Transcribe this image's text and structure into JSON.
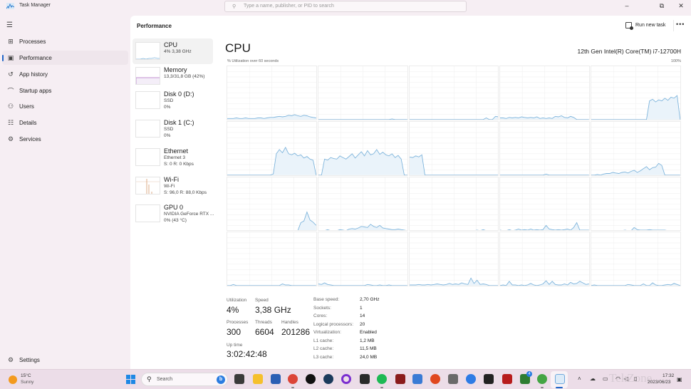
{
  "window": {
    "title": "Task Manager",
    "search_placeholder": "Type a name, publisher, or PID to search",
    "controls": {
      "minimize": "–",
      "restore": "⧉",
      "close": "✕"
    }
  },
  "nav": {
    "menu_icon": "hamburger-icon",
    "items": [
      {
        "label": "Processes",
        "icon": "processes-icon",
        "active": false
      },
      {
        "label": "Performance",
        "icon": "performance-icon",
        "active": true
      },
      {
        "label": "App history",
        "icon": "history-icon",
        "active": false
      },
      {
        "label": "Startup apps",
        "icon": "startup-icon",
        "active": false
      },
      {
        "label": "Users",
        "icon": "users-icon",
        "active": false
      },
      {
        "label": "Details",
        "icon": "details-icon",
        "active": false
      },
      {
        "label": "Services",
        "icon": "services-icon",
        "active": false
      }
    ],
    "settings_label": "Settings"
  },
  "header": {
    "title": "Performance",
    "run_new_task": "Run new task",
    "more": "•••"
  },
  "devices": [
    {
      "name": "CPU",
      "sub1": "4%  3,38 GHz",
      "sub2": "",
      "active": true
    },
    {
      "name": "Memory",
      "sub1": "13,3/31,8 GB (42%)",
      "sub2": "",
      "active": false
    },
    {
      "name": "Disk 0 (D:)",
      "sub1": "SSD",
      "sub2": "0%",
      "active": false
    },
    {
      "name": "Disk 1 (C:)",
      "sub1": "SSD",
      "sub2": "0%",
      "active": false
    },
    {
      "name": "Ethernet",
      "sub1": "Ethernet 3",
      "sub2": "S: 0  R: 0 Kbps",
      "active": false
    },
    {
      "name": "Wi-Fi",
      "sub1": "Wi-Fi",
      "sub2": "S: 96,0  R: 88,0 Kbps",
      "active": false
    },
    {
      "name": "GPU 0",
      "sub1": "NVIDIA GeForce RTX ...",
      "sub2": "0%  (43 °C)",
      "active": false
    }
  ],
  "cpu": {
    "title": "CPU",
    "model": "12th Gen Intel(R) Core(TM) i7-12700H",
    "graph_label": "% Utilization over 60 seconds",
    "graph_max": "100%",
    "colors": {
      "line": "#7fb5dc",
      "fill": "#eaf3fa",
      "grid": "#f0f0f0"
    },
    "stats": {
      "utilization": {
        "label": "Utilization",
        "value": "4%"
      },
      "speed": {
        "label": "Speed",
        "value": "3,38 GHz"
      },
      "processes": {
        "label": "Processes",
        "value": "300"
      },
      "threads": {
        "label": "Threads",
        "value": "6604"
      },
      "handles": {
        "label": "Handles",
        "value": "201286"
      },
      "uptime": {
        "label": "Up time",
        "value": "3:02:42:48"
      }
    },
    "specs": [
      {
        "label": "Base speed:",
        "value": "2,70 GHz"
      },
      {
        "label": "Sockets:",
        "value": "1"
      },
      {
        "label": "Cores:",
        "value": "14"
      },
      {
        "label": "Logical processors:",
        "value": "20"
      },
      {
        "label": "Virtualization:",
        "value": "Enabled"
      },
      {
        "label": "L1 cache:",
        "value": "1,2 MB"
      },
      {
        "label": "L2 cache:",
        "value": "11,5 MB"
      },
      {
        "label": "L3 cache:",
        "value": "24,0 MB"
      }
    ]
  },
  "chart_data": {
    "type": "area",
    "title": "% Utilization over 60 seconds",
    "ylim": [
      0,
      100
    ],
    "xlim_seconds": [
      60,
      0
    ],
    "grid": true,
    "layout_cols": 5,
    "layout_rows": 4,
    "series": [
      {
        "name": "LP0",
        "values": [
          2,
          2,
          2,
          3,
          2,
          2,
          3,
          2,
          2,
          2,
          3,
          3,
          2,
          3,
          4,
          4,
          5,
          6,
          5,
          6,
          8,
          7,
          9,
          7,
          6,
          8,
          7,
          5,
          4,
          3
        ]
      },
      {
        "name": "LP1",
        "values": [
          0,
          0,
          0,
          0,
          0,
          0,
          0,
          0,
          0,
          0,
          0,
          0,
          0,
          0,
          0,
          0,
          0,
          0,
          0,
          0,
          0,
          0,
          0,
          0,
          1,
          0,
          0,
          0,
          0,
          0
        ]
      },
      {
        "name": "LP2",
        "values": [
          0,
          0,
          0,
          0,
          0,
          0,
          0,
          0,
          0,
          0,
          0,
          0,
          0,
          0,
          0,
          0,
          0,
          0,
          0,
          0,
          0,
          0,
          0,
          0,
          0,
          3,
          0,
          0,
          6,
          5
        ]
      },
      {
        "name": "LP3",
        "values": [
          3,
          3,
          2,
          4,
          3,
          4,
          3,
          5,
          4,
          3,
          4,
          3,
          5,
          2,
          3,
          2,
          3,
          2,
          6,
          5,
          7,
          4,
          3,
          6,
          4,
          0,
          0,
          0,
          0,
          0
        ]
      },
      {
        "name": "LP4",
        "values": [
          0,
          0,
          0,
          0,
          0,
          0,
          0,
          0,
          0,
          0,
          0,
          0,
          0,
          0,
          0,
          0,
          0,
          0,
          0,
          35,
          38,
          33,
          37,
          35,
          40,
          36,
          42,
          40,
          45,
          0
        ]
      },
      {
        "name": "LP5",
        "values": [
          0,
          0,
          0,
          0,
          0,
          0,
          0,
          0,
          0,
          0,
          0,
          0,
          0,
          0,
          0,
          2,
          40,
          48,
          42,
          52,
          40,
          38,
          41,
          36,
          38,
          32,
          35,
          30,
          28,
          0
        ]
      },
      {
        "name": "LP6",
        "values": [
          0,
          0,
          30,
          28,
          33,
          31,
          30,
          36,
          33,
          30,
          35,
          40,
          32,
          38,
          44,
          36,
          46,
          38,
          40,
          48,
          39,
          43,
          38,
          36,
          40,
          33,
          37,
          30,
          0,
          0
        ]
      },
      {
        "name": "LP7",
        "values": [
          34,
          33,
          36,
          34,
          38,
          0,
          0,
          0,
          0,
          0,
          0,
          0,
          0,
          0,
          0,
          0,
          0,
          0,
          0,
          0,
          0,
          0,
          0,
          0,
          0,
          0,
          0,
          0,
          0,
          0
        ]
      },
      {
        "name": "LP8",
        "values": [
          0,
          0,
          0,
          0,
          0,
          0,
          0,
          0,
          0,
          0,
          0,
          0,
          0,
          0,
          0,
          2,
          0,
          0,
          0,
          0,
          0,
          0,
          0,
          0,
          0,
          0,
          0,
          0,
          0,
          0
        ]
      },
      {
        "name": "LP9",
        "values": [
          0,
          0,
          1,
          0,
          2,
          3,
          3,
          5,
          4,
          3,
          5,
          6,
          4,
          7,
          9,
          5,
          8,
          12,
          16,
          10,
          14,
          15,
          22,
          18,
          0,
          0,
          0,
          0,
          0,
          0
        ]
      },
      {
        "name": "LP10",
        "values": [
          0,
          0,
          0,
          0,
          0,
          0,
          0,
          0,
          0,
          0,
          0,
          0,
          0,
          0,
          0,
          0,
          0,
          0,
          0,
          0,
          0,
          0,
          0,
          0,
          15,
          18,
          35,
          20,
          16,
          10
        ]
      },
      {
        "name": "LP11",
        "values": [
          0,
          0,
          0,
          2,
          0,
          0,
          0,
          2,
          1,
          0,
          3,
          4,
          3,
          5,
          8,
          7,
          6,
          12,
          8,
          6,
          10,
          5,
          4,
          3,
          2,
          2,
          3,
          2,
          1,
          0
        ]
      },
      {
        "name": "LP12",
        "values": [
          0,
          0,
          0,
          0,
          0,
          0,
          0,
          0,
          0,
          0,
          0,
          0,
          0,
          0,
          0,
          0,
          0,
          0,
          0,
          0,
          0,
          0,
          1,
          0,
          2,
          0,
          0,
          0,
          0,
          0
        ]
      },
      {
        "name": "LP13",
        "values": [
          1,
          0,
          0,
          2,
          0,
          1,
          3,
          1,
          2,
          1,
          3,
          1,
          2,
          1,
          2,
          10,
          3,
          2,
          1,
          2,
          1,
          2,
          3,
          1,
          6,
          15,
          1,
          1,
          1,
          1
        ]
      },
      {
        "name": "LP14",
        "values": [
          0,
          0,
          0,
          0,
          0,
          0,
          0,
          0,
          0,
          0,
          0,
          1,
          0,
          0,
          6,
          2,
          1,
          1,
          1,
          2,
          1,
          1,
          1,
          1,
          1,
          0,
          0,
          0,
          0,
          0
        ]
      },
      {
        "name": "LP15",
        "values": [
          0,
          0,
          2,
          0,
          0,
          0,
          0,
          0,
          0,
          0,
          0,
          0,
          0,
          0,
          0,
          0,
          0,
          0,
          3,
          1,
          1,
          0,
          0,
          0,
          0,
          0,
          0,
          0,
          0,
          0
        ]
      },
      {
        "name": "LP16",
        "values": [
          3,
          2,
          5,
          2,
          1,
          0,
          0,
          0,
          0,
          0,
          0,
          0,
          0,
          0,
          0,
          0,
          2,
          1,
          0,
          0,
          1,
          0,
          0,
          1,
          0,
          0,
          0,
          0,
          0,
          0
        ]
      },
      {
        "name": "LP17",
        "values": [
          1,
          1,
          1,
          2,
          1,
          1,
          2,
          1,
          2,
          3,
          2,
          1,
          2,
          4,
          2,
          3,
          2,
          5,
          3,
          2,
          14,
          4,
          10,
          2,
          3,
          2,
          0,
          0,
          0,
          0
        ]
      },
      {
        "name": "LP18",
        "values": [
          0,
          1,
          0,
          8,
          1,
          1,
          0,
          1,
          0,
          1,
          4,
          1,
          0,
          1,
          3,
          9,
          2,
          8,
          2,
          1,
          1,
          3,
          1,
          6,
          3,
          4,
          8,
          5,
          2,
          3
        ]
      },
      {
        "name": "LP19",
        "values": [
          0,
          1,
          0,
          0,
          0,
          0,
          0,
          0,
          0,
          0,
          0,
          0,
          2,
          1,
          0,
          0,
          0,
          3,
          0,
          0,
          5,
          1,
          0,
          0,
          1,
          2,
          1,
          4,
          2,
          0
        ]
      }
    ]
  },
  "taskbar": {
    "weather": {
      "temp": "15°C",
      "condition": "Sunny"
    },
    "search_label": "Search",
    "apps": [
      {
        "name": "task-view",
        "color": "#3a3a3a",
        "running": false
      },
      {
        "name": "file-explorer",
        "color": "#f5c02c",
        "running": false
      },
      {
        "name": "microsoft-store",
        "color": "#2b5fb4",
        "running": false
      },
      {
        "name": "chrome",
        "color": "#db4437",
        "running": true
      },
      {
        "name": "logitech-g-hub",
        "color": "#111111",
        "running": false
      },
      {
        "name": "steam",
        "color": "#1b3a5c",
        "running": false
      },
      {
        "name": "cortana",
        "color": "#7b2fd0",
        "running": false
      },
      {
        "name": "epic-games",
        "color": "#2a2a2a",
        "running": false
      },
      {
        "name": "spotify",
        "color": "#1db954",
        "running": true
      },
      {
        "name": "game-app",
        "color": "#8a1c1c",
        "running": false
      },
      {
        "name": "network-app",
        "color": "#3a7bd5",
        "running": false
      },
      {
        "name": "ea-app",
        "color": "#e0481f",
        "running": false
      },
      {
        "name": "quake",
        "color": "#6a6a6a",
        "running": false
      },
      {
        "name": "blue-app",
        "color": "#2d7be5",
        "running": false
      },
      {
        "name": "amazon",
        "color": "#222222",
        "running": false
      },
      {
        "name": "red-app",
        "color": "#b71c1c",
        "running": false
      },
      {
        "name": "xbox",
        "color": "#2e7d32",
        "running": false,
        "badge": "4"
      },
      {
        "name": "razer",
        "color": "#44a544",
        "running": true
      },
      {
        "name": "task-manager",
        "color": "#6fa8dc",
        "running": true,
        "active": true
      }
    ],
    "tray_icons": [
      "chevron-up-icon",
      "onedrive-icon",
      "display-icon",
      "wifi-icon",
      "volume-icon",
      "battery-icon"
    ],
    "clock": {
      "time": "17:32",
      "date": "2023/06/23"
    },
    "watermark": "TekZone"
  }
}
